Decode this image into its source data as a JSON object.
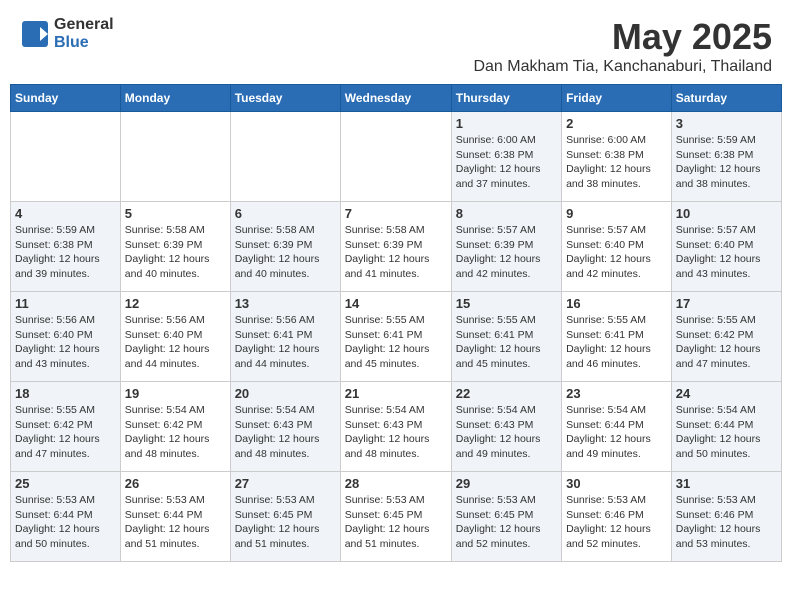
{
  "header": {
    "logo": {
      "general": "General",
      "blue": "Blue",
      "tagline": ""
    },
    "title": "May 2025",
    "location": "Dan Makham Tia, Kanchanaburi, Thailand"
  },
  "weekdays": [
    "Sunday",
    "Monday",
    "Tuesday",
    "Wednesday",
    "Thursday",
    "Friday",
    "Saturday"
  ],
  "weeks": [
    [
      {
        "day": "",
        "detail": ""
      },
      {
        "day": "",
        "detail": ""
      },
      {
        "day": "",
        "detail": ""
      },
      {
        "day": "",
        "detail": ""
      },
      {
        "day": "1",
        "detail": "Sunrise: 6:00 AM\nSunset: 6:38 PM\nDaylight: 12 hours\nand 37 minutes."
      },
      {
        "day": "2",
        "detail": "Sunrise: 6:00 AM\nSunset: 6:38 PM\nDaylight: 12 hours\nand 38 minutes."
      },
      {
        "day": "3",
        "detail": "Sunrise: 5:59 AM\nSunset: 6:38 PM\nDaylight: 12 hours\nand 38 minutes."
      }
    ],
    [
      {
        "day": "4",
        "detail": "Sunrise: 5:59 AM\nSunset: 6:38 PM\nDaylight: 12 hours\nand 39 minutes."
      },
      {
        "day": "5",
        "detail": "Sunrise: 5:58 AM\nSunset: 6:39 PM\nDaylight: 12 hours\nand 40 minutes."
      },
      {
        "day": "6",
        "detail": "Sunrise: 5:58 AM\nSunset: 6:39 PM\nDaylight: 12 hours\nand 40 minutes."
      },
      {
        "day": "7",
        "detail": "Sunrise: 5:58 AM\nSunset: 6:39 PM\nDaylight: 12 hours\nand 41 minutes."
      },
      {
        "day": "8",
        "detail": "Sunrise: 5:57 AM\nSunset: 6:39 PM\nDaylight: 12 hours\nand 42 minutes."
      },
      {
        "day": "9",
        "detail": "Sunrise: 5:57 AM\nSunset: 6:40 PM\nDaylight: 12 hours\nand 42 minutes."
      },
      {
        "day": "10",
        "detail": "Sunrise: 5:57 AM\nSunset: 6:40 PM\nDaylight: 12 hours\nand 43 minutes."
      }
    ],
    [
      {
        "day": "11",
        "detail": "Sunrise: 5:56 AM\nSunset: 6:40 PM\nDaylight: 12 hours\nand 43 minutes."
      },
      {
        "day": "12",
        "detail": "Sunrise: 5:56 AM\nSunset: 6:40 PM\nDaylight: 12 hours\nand 44 minutes."
      },
      {
        "day": "13",
        "detail": "Sunrise: 5:56 AM\nSunset: 6:41 PM\nDaylight: 12 hours\nand 44 minutes."
      },
      {
        "day": "14",
        "detail": "Sunrise: 5:55 AM\nSunset: 6:41 PM\nDaylight: 12 hours\nand 45 minutes."
      },
      {
        "day": "15",
        "detail": "Sunrise: 5:55 AM\nSunset: 6:41 PM\nDaylight: 12 hours\nand 45 minutes."
      },
      {
        "day": "16",
        "detail": "Sunrise: 5:55 AM\nSunset: 6:41 PM\nDaylight: 12 hours\nand 46 minutes."
      },
      {
        "day": "17",
        "detail": "Sunrise: 5:55 AM\nSunset: 6:42 PM\nDaylight: 12 hours\nand 47 minutes."
      }
    ],
    [
      {
        "day": "18",
        "detail": "Sunrise: 5:55 AM\nSunset: 6:42 PM\nDaylight: 12 hours\nand 47 minutes."
      },
      {
        "day": "19",
        "detail": "Sunrise: 5:54 AM\nSunset: 6:42 PM\nDaylight: 12 hours\nand 48 minutes."
      },
      {
        "day": "20",
        "detail": "Sunrise: 5:54 AM\nSunset: 6:43 PM\nDaylight: 12 hours\nand 48 minutes."
      },
      {
        "day": "21",
        "detail": "Sunrise: 5:54 AM\nSunset: 6:43 PM\nDaylight: 12 hours\nand 48 minutes."
      },
      {
        "day": "22",
        "detail": "Sunrise: 5:54 AM\nSunset: 6:43 PM\nDaylight: 12 hours\nand 49 minutes."
      },
      {
        "day": "23",
        "detail": "Sunrise: 5:54 AM\nSunset: 6:44 PM\nDaylight: 12 hours\nand 49 minutes."
      },
      {
        "day": "24",
        "detail": "Sunrise: 5:54 AM\nSunset: 6:44 PM\nDaylight: 12 hours\nand 50 minutes."
      }
    ],
    [
      {
        "day": "25",
        "detail": "Sunrise: 5:53 AM\nSunset: 6:44 PM\nDaylight: 12 hours\nand 50 minutes."
      },
      {
        "day": "26",
        "detail": "Sunrise: 5:53 AM\nSunset: 6:44 PM\nDaylight: 12 hours\nand 51 minutes."
      },
      {
        "day": "27",
        "detail": "Sunrise: 5:53 AM\nSunset: 6:45 PM\nDaylight: 12 hours\nand 51 minutes."
      },
      {
        "day": "28",
        "detail": "Sunrise: 5:53 AM\nSunset: 6:45 PM\nDaylight: 12 hours\nand 51 minutes."
      },
      {
        "day": "29",
        "detail": "Sunrise: 5:53 AM\nSunset: 6:45 PM\nDaylight: 12 hours\nand 52 minutes."
      },
      {
        "day": "30",
        "detail": "Sunrise: 5:53 AM\nSunset: 6:46 PM\nDaylight: 12 hours\nand 52 minutes."
      },
      {
        "day": "31",
        "detail": "Sunrise: 5:53 AM\nSunset: 6:46 PM\nDaylight: 12 hours\nand 53 minutes."
      }
    ]
  ]
}
